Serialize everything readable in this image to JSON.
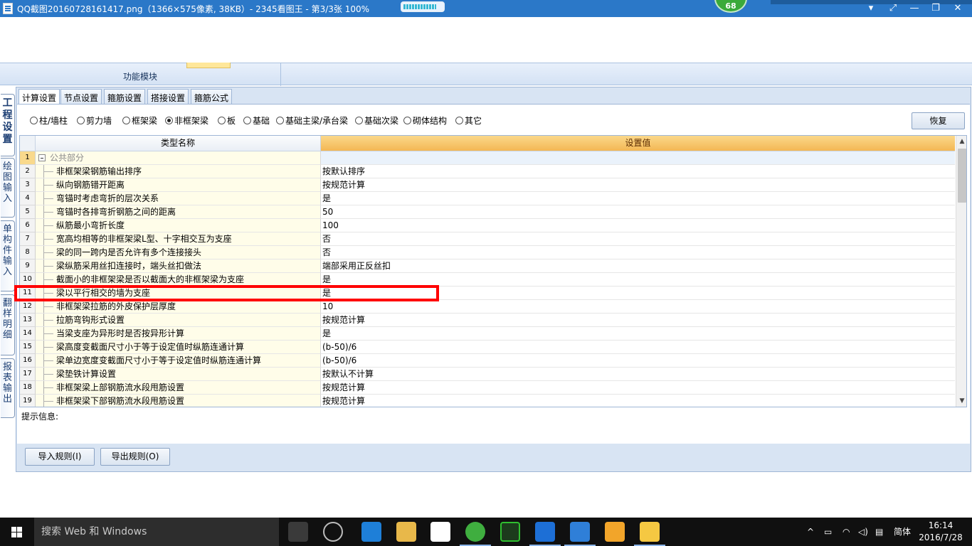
{
  "window": {
    "title": "QQ截图20160728161417.png（1366×575像素, 38KB）- 2345看图王 - 第3/3张 100%",
    "badge": "68",
    "progress_fraction": 0.85,
    "controls": [
      "▾",
      "⤢",
      "—",
      "❐",
      "✕"
    ]
  },
  "module_bar": {
    "label": "功能模块"
  },
  "side_tabs": [
    {
      "label": "工程设置",
      "active": true
    },
    {
      "label": "绘图输入",
      "active": false
    },
    {
      "label": "单构件输入",
      "active": false
    },
    {
      "label": "翻样明细",
      "active": false
    },
    {
      "label": "报表输出",
      "active": false
    }
  ],
  "tabs": [
    {
      "label": "计算设置",
      "active": true
    },
    {
      "label": "节点设置",
      "active": false
    },
    {
      "label": "箍筋设置",
      "active": false
    },
    {
      "label": "搭接设置",
      "active": false
    },
    {
      "label": "箍筋公式",
      "active": false
    }
  ],
  "radios": [
    {
      "label": "柱/墙柱",
      "checked": false
    },
    {
      "label": "剪力墙",
      "checked": false
    },
    {
      "label": "框架梁",
      "checked": false
    },
    {
      "label": "非框架梁",
      "checked": true
    },
    {
      "label": "板",
      "checked": false
    },
    {
      "label": "基础",
      "checked": false
    },
    {
      "label": "基础主梁/承台梁",
      "checked": false
    },
    {
      "label": "基础次梁",
      "checked": false
    },
    {
      "label": "砌体结构",
      "checked": false
    },
    {
      "label": "其它",
      "checked": false
    }
  ],
  "restore_button": "恢复",
  "grid": {
    "col_name": "类型名称",
    "col_value": "设置值",
    "group": {
      "num": "1",
      "label": "公共部分"
    },
    "rows": [
      {
        "num": "2",
        "name": "非框架梁钢筋输出排序",
        "value": "按默认排序"
      },
      {
        "num": "3",
        "name": "纵向钢筋错开距离",
        "value": "按规范计算"
      },
      {
        "num": "4",
        "name": "弯锚时考虑弯折的层次关系",
        "value": "是"
      },
      {
        "num": "5",
        "name": "弯锚时各排弯折钢筋之间的距离",
        "value": "50"
      },
      {
        "num": "6",
        "name": "纵筋最小弯折长度",
        "value": "100"
      },
      {
        "num": "7",
        "name": "宽高均相等的非框架梁L型、十字相交互为支座",
        "value": "否"
      },
      {
        "num": "8",
        "name": "梁的同一跨内是否允许有多个连接接头",
        "value": "否"
      },
      {
        "num": "9",
        "name": "梁纵筋采用丝扣连接时，端头丝扣做法",
        "value": "端部采用正反丝扣"
      },
      {
        "num": "10",
        "name": "截面小的非框架梁是否以截面大的非框架梁为支座",
        "value": "是"
      },
      {
        "num": "11",
        "name": "梁以平行相交的墙为支座",
        "value": "是"
      },
      {
        "num": "12",
        "name": "非框架梁拉筋的外皮保护层厚度",
        "value": "10"
      },
      {
        "num": "13",
        "name": "拉筋弯钩形式设置",
        "value": "按规范计算"
      },
      {
        "num": "14",
        "name": "当梁支座为异形时是否按异形计算",
        "value": "是"
      },
      {
        "num": "15",
        "name": "梁高度变截面尺寸小于等于设定值时纵筋连通计算",
        "value": "(b-50)/6"
      },
      {
        "num": "16",
        "name": "梁单边宽度变截面尺寸小于等于设定值时纵筋连通计算",
        "value": "(b-50)/6"
      },
      {
        "num": "17",
        "name": "梁垫铁计算设置",
        "value": "按默认不计算"
      },
      {
        "num": "18",
        "name": "非框架梁上部钢筋流水段甩筋设置",
        "value": "按规范计算"
      },
      {
        "num": "19",
        "name": "非框架梁下部钢筋流水段甩筋设置",
        "value": "按规范计算"
      }
    ]
  },
  "hint": "提示信息:",
  "buttons": {
    "import": "导入规则(I)",
    "export": "导出规则(O)"
  },
  "taskbar": {
    "search_placeholder": "搜索 Web 和 Windows",
    "ime": "简体",
    "time": "16:14",
    "date": "2016/7/28",
    "tray_symbols": [
      "^",
      "▭",
      "◠",
      "◁)",
      "▤"
    ]
  },
  "colors": {
    "title_bar": "#2b78c8",
    "value_header": "#f3b754",
    "highlight": "#ff0000"
  }
}
